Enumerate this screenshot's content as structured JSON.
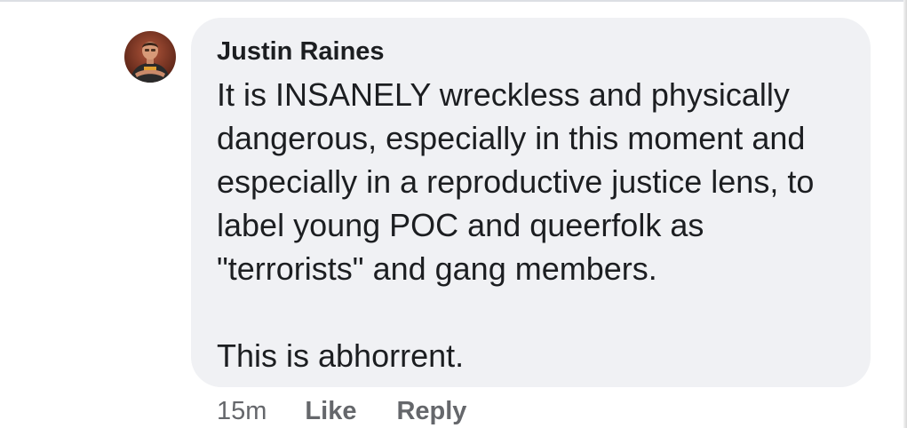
{
  "comment": {
    "author": "Justin Raines",
    "avatar_icon": "user-avatar",
    "paragraphs": [
      "It is INSANELY wreckless and physically dangerous, especially in this moment and especially in a reproductive justice lens, to label young POC and queerfolk as \"terrorists\" and gang members.",
      "This is abhorrent."
    ],
    "timestamp": "15m",
    "actions": {
      "like": "Like",
      "reply": "Reply"
    }
  },
  "colors": {
    "bubble_bg": "#f0f1f4",
    "text": "#1c1e21",
    "meta": "#65676b"
  }
}
